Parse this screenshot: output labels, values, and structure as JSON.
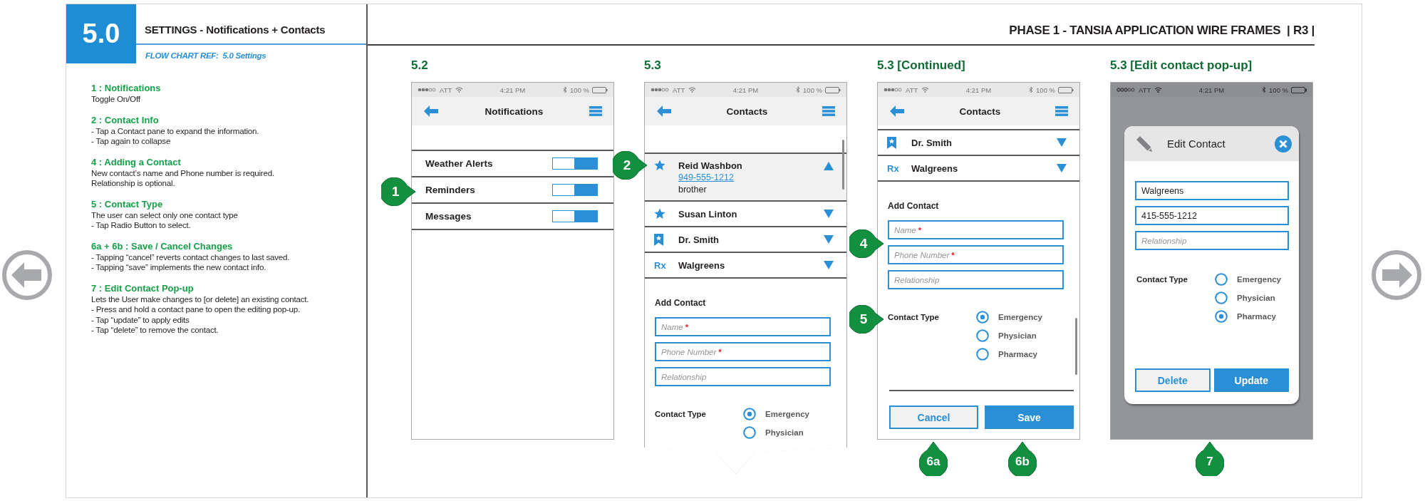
{
  "page": {
    "section_number": "5.0",
    "title": "SETTINGS - Notifications + Contacts",
    "flow_chart_ref": "FLOW CHART REF:  5.0 Settings",
    "document_title": "PHASE 1 - TANSIA APPLICATION WIRE FRAMES  | R3 |"
  },
  "notes": [
    {
      "heading": "1 : Notifications",
      "lines": [
        "Toggle On/Off"
      ]
    },
    {
      "heading": "2  : Contact Info",
      "lines": [
        "- Tap a Contact pane to expand the information.",
        "- Tap again to collapse"
      ]
    },
    {
      "heading": "4 : Adding a Contact",
      "lines": [
        "New contact’s name and Phone number is required.",
        "Relationship is optional."
      ]
    },
    {
      "heading": "5 : Contact Type",
      "lines": [
        "The user can select only one contact type",
        "- Tap Radio Button to select."
      ]
    },
    {
      "heading": "6a + 6b : Save / Cancel Changes",
      "lines": [
        "- Tapping “cancel” reverts contact changes to last saved.",
        "- Tapping “save” implements the new contact info."
      ]
    },
    {
      "heading": "7 : Edit Contact Pop-up",
      "lines": [
        "Lets the User make changes to [or delete] an existing contact.",
        "- Press and hold a contact pane to open the editing pop-up.",
        "- Tap “update” to apply edits",
        "- Tap “delete” to remove the contact."
      ]
    }
  ],
  "screens": [
    {
      "kind": "notifications",
      "label": "5.2",
      "torn_bottom": false,
      "status_bar": {
        "carrier": "ATT",
        "time": "4:21 PM",
        "battery": "100 %"
      },
      "nav_title": "Notifications",
      "toggles": [
        {
          "label": "Weather Alerts",
          "on": true
        },
        {
          "label": "Reminders",
          "on": true
        },
        {
          "label": "Messages",
          "on": true
        }
      ]
    },
    {
      "kind": "contacts",
      "label": "5.3",
      "torn_bottom": true,
      "status_bar": {
        "carrier": "ATT",
        "time": "4:21 PM",
        "battery": "100 %"
      },
      "nav_title": "Contacts",
      "contacts": [
        {
          "kind": "favorite",
          "name": "Reid Washbon",
          "expanded": true,
          "phone": "949-555-1212",
          "relationship": "brother"
        },
        {
          "kind": "favorite",
          "name": "Susan Linton",
          "expanded": false
        },
        {
          "kind": "doctor",
          "name": "Dr. Smith",
          "expanded": false
        },
        {
          "kind": "pharmacy",
          "badge": "Rx",
          "name": "Walgreens",
          "expanded": false
        }
      ],
      "add_contact": {
        "heading": "Add Contact",
        "fields": [
          {
            "placeholder": "Name",
            "required_mark": "*"
          },
          {
            "placeholder": "Phone Number",
            "required_mark": "*"
          },
          {
            "placeholder": "Relationship"
          }
        ],
        "type_label": "Contact Type",
        "options": [
          {
            "label": "Emergency",
            "selected": true
          },
          {
            "label": "Physician",
            "selected": false
          }
        ]
      }
    },
    {
      "kind": "contacts",
      "label": "5.3 [Continued]",
      "torn_bottom": false,
      "status_bar": {
        "carrier": "ATT",
        "time": "4:21 PM",
        "battery": "100 %"
      },
      "nav_title": "Contacts",
      "contacts": [
        {
          "kind": "doctor",
          "name": "Dr. Smith",
          "expanded": false
        },
        {
          "kind": "pharmacy",
          "badge": "Rx",
          "name": "Walgreens",
          "expanded": false
        }
      ],
      "add_contact": {
        "heading": "Add Contact",
        "fields": [
          {
            "placeholder": "Name",
            "required_mark": "*"
          },
          {
            "placeholder": "Phone Number",
            "required_mark": "*"
          },
          {
            "placeholder": "Relationship"
          }
        ],
        "type_label": "Contact Type",
        "options": [
          {
            "label": "Emergency",
            "selected": true
          },
          {
            "label": "Physician",
            "selected": false
          },
          {
            "label": "Pharmacy",
            "selected": false
          }
        ]
      },
      "buttons": [
        {
          "kind": "secondary",
          "label": "Cancel"
        },
        {
          "kind": "primary",
          "label": "Save"
        }
      ]
    },
    {
      "kind": "edit_popup",
      "label": "5.3 [Edit contact pop-up]",
      "torn_bottom": false,
      "status_bar": {
        "carrier": "ATT",
        "time": "4:21 PM",
        "battery": "100 %"
      },
      "dialog": {
        "title": "Edit Contact",
        "fields": [
          {
            "value": "Walgreens"
          },
          {
            "value": "415-555-1212"
          },
          {
            "placeholder": "Relationship"
          }
        ],
        "type_label": "Contact Type",
        "options": [
          {
            "label": "Emergency",
            "selected": false
          },
          {
            "label": "Physician",
            "selected": false
          },
          {
            "label": "Pharmacy",
            "selected": true
          }
        ],
        "buttons": [
          {
            "kind": "secondary",
            "label": "Delete"
          },
          {
            "kind": "primary",
            "label": "Update"
          }
        ]
      }
    }
  ],
  "callouts": [
    {
      "label": "1",
      "kind": "side"
    },
    {
      "label": "2",
      "kind": "side"
    },
    {
      "label": "4",
      "kind": "side"
    },
    {
      "label": "5",
      "kind": "side"
    },
    {
      "label": "6a",
      "kind": "below"
    },
    {
      "label": "6b",
      "kind": "below"
    },
    {
      "label": "7",
      "kind": "below"
    }
  ]
}
